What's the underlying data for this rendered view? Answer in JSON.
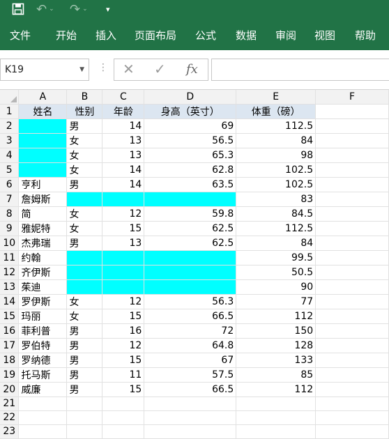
{
  "quick_access": {
    "save_icon": "save-icon",
    "undo_icon": "undo-icon",
    "redo_icon": "redo-icon",
    "customize_icon": "customize-icon"
  },
  "ribbon": {
    "tabs": [
      "文件",
      "开始",
      "插入",
      "页面布局",
      "公式",
      "数据",
      "审阅",
      "视图",
      "帮助"
    ]
  },
  "formula_bar": {
    "name_box": "K19",
    "formula": ""
  },
  "colors": {
    "accent": "#217346",
    "highlight": "#00ffff",
    "header_fill": "#dce6f1",
    "header_text": "#1f3c88"
  },
  "sheet": {
    "columns": [
      "A",
      "B",
      "C",
      "D",
      "E",
      "F"
    ],
    "header_row": [
      "姓名",
      "性别",
      "年龄",
      "身高（英寸）",
      "体重（磅）"
    ],
    "rows": [
      [
        "",
        "男",
        "14",
        "69",
        "112.5"
      ],
      [
        "",
        "女",
        "13",
        "56.5",
        "84"
      ],
      [
        "",
        "女",
        "13",
        "65.3",
        "98"
      ],
      [
        "",
        "女",
        "14",
        "62.8",
        "102.5"
      ],
      [
        "亨利",
        "男",
        "14",
        "63.5",
        "102.5"
      ],
      [
        "詹姆斯",
        "",
        "",
        "",
        "83"
      ],
      [
        "简",
        "女",
        "12",
        "59.8",
        "84.5"
      ],
      [
        "雅妮特",
        "女",
        "15",
        "62.5",
        "112.5"
      ],
      [
        "杰弗瑞",
        "男",
        "13",
        "62.5",
        "84"
      ],
      [
        "约翰",
        "",
        "",
        "",
        "99.5"
      ],
      [
        "齐伊斯",
        "",
        "",
        "",
        "50.5"
      ],
      [
        "茱迪",
        "",
        "",
        "",
        "90"
      ],
      [
        "罗伊斯",
        "女",
        "12",
        "56.3",
        "77"
      ],
      [
        "玛丽",
        "女",
        "15",
        "66.5",
        "112"
      ],
      [
        "菲利普",
        "男",
        "16",
        "72",
        "150"
      ],
      [
        "罗伯特",
        "男",
        "12",
        "64.8",
        "128"
      ],
      [
        "罗纳德",
        "男",
        "15",
        "67",
        "133"
      ],
      [
        "托马斯",
        "男",
        "11",
        "57.5",
        "85"
      ],
      [
        "威廉",
        "男",
        "15",
        "66.5",
        "112"
      ]
    ],
    "highlighted_cells": [
      "A2",
      "A3",
      "A4",
      "A5",
      "B7",
      "C7",
      "D7",
      "B11",
      "C11",
      "D11",
      "B12",
      "C12",
      "D12",
      "B13",
      "C13",
      "D13"
    ],
    "row_numbers": [
      "1",
      "2",
      "3",
      "4",
      "5",
      "6",
      "7",
      "8",
      "9",
      "10",
      "11",
      "12",
      "13",
      "14",
      "15",
      "16",
      "17",
      "18",
      "19",
      "20",
      "21",
      "22",
      "23"
    ]
  }
}
